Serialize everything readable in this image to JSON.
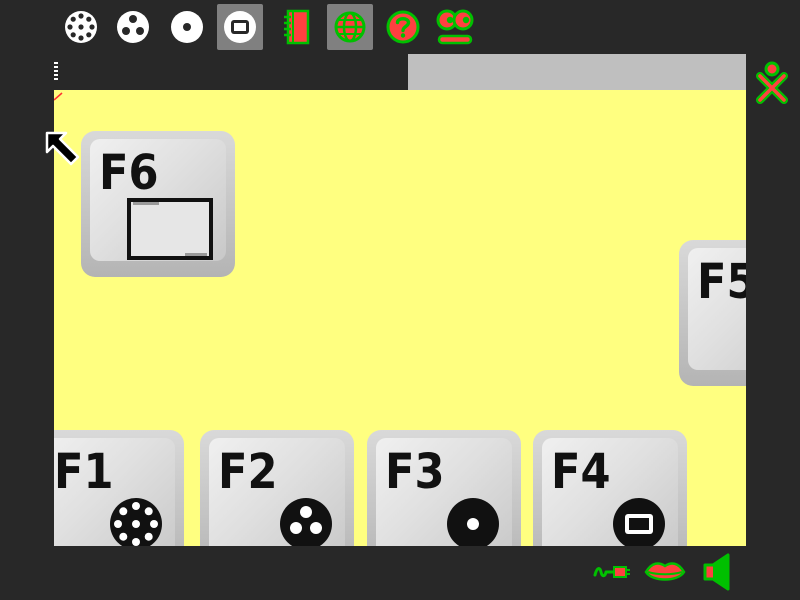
{
  "toolbar": {
    "items": [
      {
        "name": "eight-dot-circle-icon",
        "active": false
      },
      {
        "name": "three-dot-circle-icon",
        "active": false
      },
      {
        "name": "one-dot-circle-icon",
        "active": false
      },
      {
        "name": "square-circle-icon",
        "active": true
      },
      {
        "name": "journal-icon",
        "active": false
      },
      {
        "name": "globe-icon",
        "active": true
      },
      {
        "name": "help-icon",
        "active": false
      },
      {
        "name": "robot-face-icon",
        "active": false
      }
    ]
  },
  "canvas": {
    "keys": {
      "f6": {
        "label": "F6"
      },
      "f5": {
        "label": "F5"
      },
      "f1": {
        "label": "F1"
      },
      "f2": {
        "label": "F2"
      },
      "f3": {
        "label": "F3"
      },
      "f4": {
        "label": "F4"
      }
    }
  },
  "bottom_bar": {
    "icons": [
      "network-icon",
      "speech-lips-icon",
      "speaker-icon"
    ]
  },
  "colors": {
    "frame": "#282828",
    "canvas_bg": "#ffff80",
    "accent_green": "#00c000",
    "accent_red": "#ff4040"
  }
}
